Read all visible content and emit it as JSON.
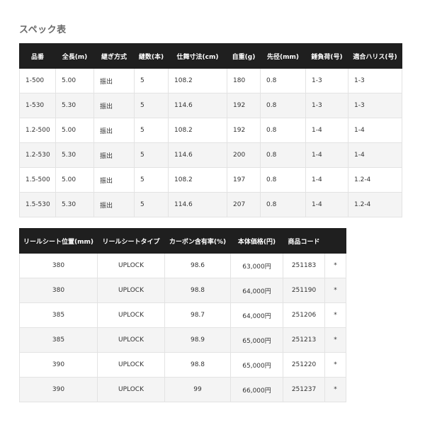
{
  "title": "スペック表",
  "table1": {
    "headers": [
      "品番",
      "全長(m)",
      "継ぎ方式",
      "継数(本)",
      "仕舞寸法(cm)",
      "自重(g)",
      "先径(mm)",
      "錘負荷(号)",
      "適合ハリス(号)"
    ],
    "rows": [
      [
        "1-500",
        "5.00",
        "振出",
        "5",
        "108.2",
        "180",
        "0.8",
        "1-3",
        "1-3"
      ],
      [
        "1-530",
        "5.30",
        "振出",
        "5",
        "114.6",
        "192",
        "0.8",
        "1-3",
        "1-3"
      ],
      [
        "1.2-500",
        "5.00",
        "振出",
        "5",
        "108.2",
        "192",
        "0.8",
        "1-4",
        "1-4"
      ],
      [
        "1.2-530",
        "5.30",
        "振出",
        "5",
        "114.6",
        "200",
        "0.8",
        "1-4",
        "1-4"
      ],
      [
        "1.5-500",
        "5.00",
        "振出",
        "5",
        "108.2",
        "197",
        "0.8",
        "1-4",
        "1.2-4"
      ],
      [
        "1.5-530",
        "5.30",
        "振出",
        "5",
        "114.6",
        "207",
        "0.8",
        "1-4",
        "1.2-4"
      ]
    ]
  },
  "table2": {
    "headers": [
      "リールシート位置(mm)",
      "リールシートタイプ",
      "カーボン含有率(%)",
      "本体価格(円)",
      "商品コード",
      ""
    ],
    "rows": [
      [
        "380",
        "UPLOCK",
        "98.6",
        "63,000円",
        "251183",
        "*"
      ],
      [
        "380",
        "UPLOCK",
        "98.8",
        "64,000円",
        "251190",
        "*"
      ],
      [
        "385",
        "UPLOCK",
        "98.7",
        "64,000円",
        "251206",
        "*"
      ],
      [
        "385",
        "UPLOCK",
        "98.9",
        "65,000円",
        "251213",
        "*"
      ],
      [
        "390",
        "UPLOCK",
        "98.8",
        "65,000円",
        "251220",
        "*"
      ],
      [
        "390",
        "UPLOCK",
        "99",
        "66,000円",
        "251237",
        "*"
      ]
    ]
  }
}
